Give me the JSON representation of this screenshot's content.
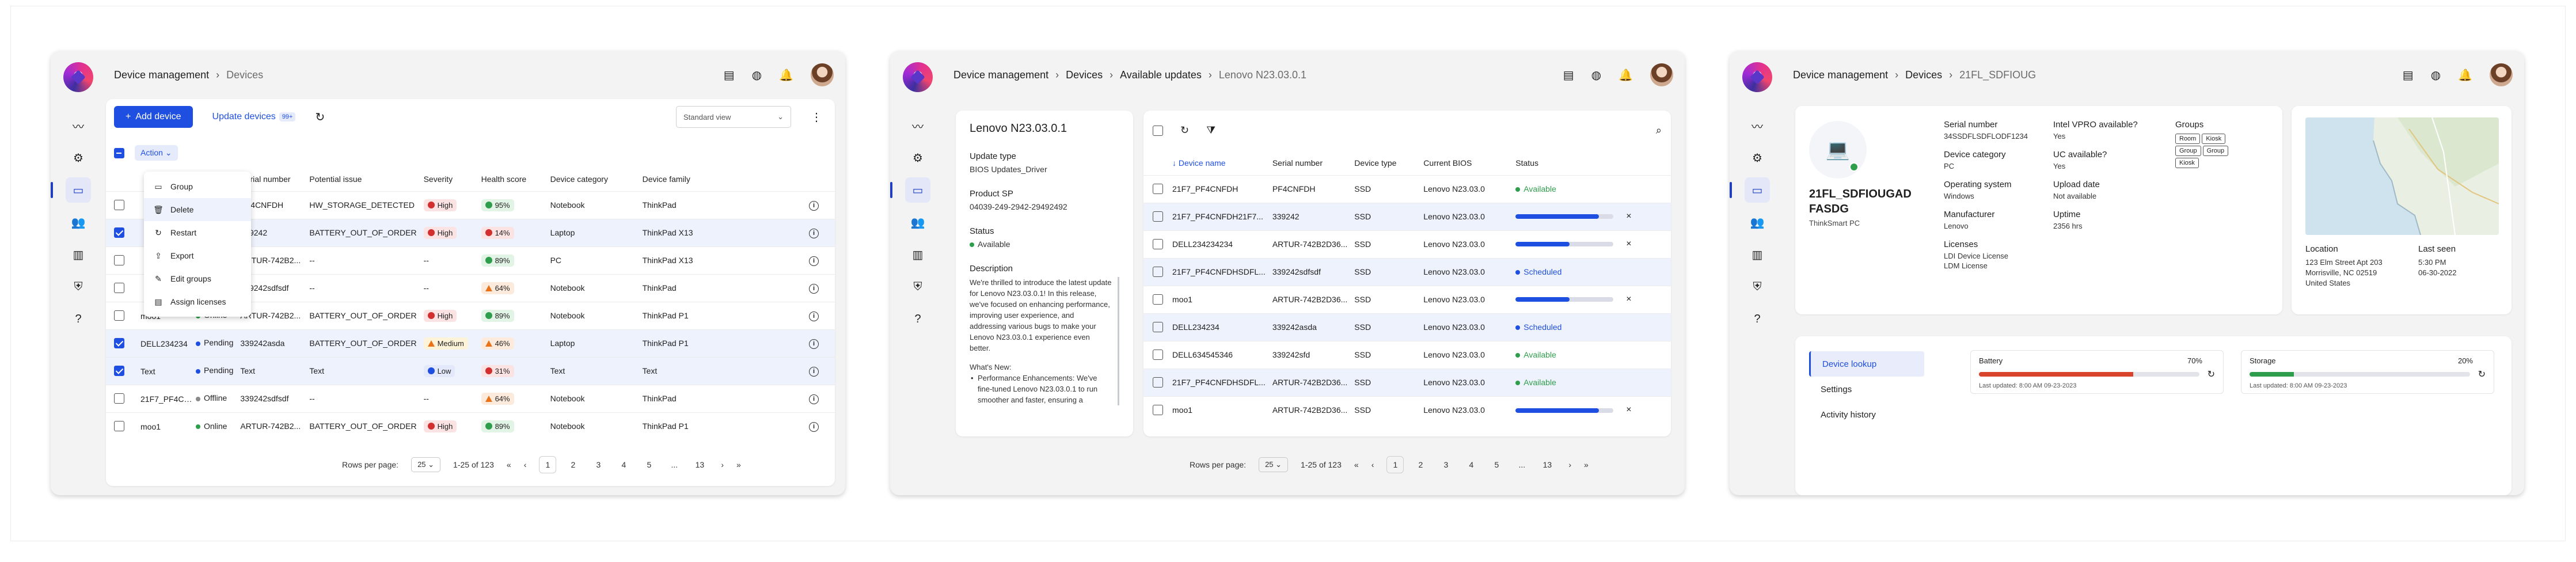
{
  "screen1": {
    "breadcrumb": [
      "Device management",
      "Devices"
    ],
    "add_device": "Add device",
    "update_devices": "Update devices",
    "update_chip": "99+",
    "view_select": "Standard view",
    "action_label": "Action",
    "columns": [
      "",
      "Status",
      "Serial number",
      "Potential issue",
      "Severity",
      "Health score",
      "Device category",
      "Device family",
      ""
    ],
    "rows": [
      {
        "sel": false,
        "name": "",
        "status": "Offline",
        "status_color": "#8a8a8a",
        "serial": "PF4CNFDH",
        "issue": "HW_STORAGE_DETECTED",
        "severity": "High",
        "sev": "high",
        "health": "95%",
        "hc": "green",
        "category": "Notebook",
        "family": "ThinkPad"
      },
      {
        "sel": true,
        "name": "",
        "status": "Offline",
        "status_color": "#8a8a8a",
        "serial": "339242",
        "issue": "BATTERY_OUT_OF_ORDER",
        "severity": "High",
        "sev": "high",
        "health": "14%",
        "hc": "red",
        "category": "Laptop",
        "family": "ThinkPad X13"
      },
      {
        "sel": false,
        "name": "",
        "status": "Online",
        "status_color": "#2e9e4c",
        "serial": "ARTUR-742B2...",
        "issue": "--",
        "severity": "--",
        "sev": "",
        "health": "89%",
        "hc": "green",
        "category": "PC",
        "family": "ThinkPad X13"
      },
      {
        "sel": false,
        "name": "",
        "status": "Offline",
        "status_color": "#8a8a8a",
        "serial": "339242sdfsdf",
        "issue": "--",
        "severity": "--",
        "sev": "",
        "health": "64%",
        "hc": "orange",
        "category": "Notebook",
        "family": "ThinkPad"
      },
      {
        "sel": false,
        "name": "moo1",
        "status": "Online",
        "status_color": "#2e9e4c",
        "serial": "ARTUR-742B2...",
        "issue": "BATTERY_OUT_OF_ORDER",
        "severity": "High",
        "sev": "high",
        "health": "89%",
        "hc": "green",
        "category": "Notebook",
        "family": "ThinkPad P1"
      },
      {
        "sel": true,
        "name": "DELL234234",
        "status": "Pending",
        "status_color": "#1f4fe0",
        "serial": "339242asda",
        "issue": "BATTERY_OUT_OF_ORDER",
        "severity": "Medium",
        "sev": "med",
        "health": "46%",
        "hc": "orange",
        "category": "Laptop",
        "family": "ThinkPad P1"
      },
      {
        "sel": true,
        "name": "Text",
        "status": "Pending",
        "status_color": "#1f4fe0",
        "serial": "Text",
        "issue": "Text",
        "severity": "Low",
        "sev": "low",
        "health": "31%",
        "hc": "red",
        "category": "Text",
        "family": "Text"
      },
      {
        "sel": false,
        "name": "21F7_PF4CNFDHSDFL...",
        "status": "Offline",
        "status_color": "#8a8a8a",
        "serial": "339242sdfsdf",
        "issue": "--",
        "severity": "--",
        "sev": "",
        "health": "64%",
        "hc": "orange",
        "category": "Notebook",
        "family": "ThinkPad"
      },
      {
        "sel": false,
        "name": "moo1",
        "status": "Online",
        "status_color": "#2e9e4c",
        "serial": "ARTUR-742B2...",
        "issue": "BATTERY_OUT_OF_ORDER",
        "severity": "High",
        "sev": "high",
        "health": "89%",
        "hc": "green",
        "category": "Notebook",
        "family": "ThinkPad P1"
      }
    ],
    "menu": [
      "Group",
      "Delete",
      "Restart",
      "Export",
      "Edit groups",
      "Assign licenses"
    ],
    "menu_icons": [
      "group-icon",
      "delete-icon",
      "restart-icon",
      "export-icon",
      "edit-icon",
      "license-icon"
    ],
    "menu_glyphs": [
      "▭",
      "🗑",
      "↻",
      "⇪",
      "✎",
      "▤"
    ],
    "pager": {
      "rows_label": "Rows per page:",
      "rows_value": "25",
      "range": "1-25 of 123",
      "pages": [
        "1",
        "2",
        "3",
        "4",
        "5",
        "...",
        "13"
      ]
    }
  },
  "screen2": {
    "breadcrumb": [
      "Device management",
      "Devices",
      "Available updates",
      "Lenovo N23.03.0.1"
    ],
    "title": "Lenovo N23.03.0.1",
    "fields": [
      {
        "label": "Update type",
        "value": "BIOS Updates_Driver"
      },
      {
        "label": "Product SP",
        "value": "04039-249-2942-29492492"
      }
    ],
    "status_label": "Status",
    "status_value": "Available",
    "description_label": "Description",
    "description": "We're thrilled to introduce the latest update for Lenovo N23.03.0.1! In this release, we've focused on enhancing performance, improving user experience, and addressing various bugs to make your Lenovo N23.03.0.1 experience even better.",
    "whats_new": "What's New:",
    "bullet": "Performance Enhancements: We've fine-tuned Lenovo N23.03.0.1 to run smoother and faster, ensuring a",
    "columns": [
      "Device name",
      "Serial number",
      "Device type",
      "Current BIOS",
      "Status"
    ],
    "rows": [
      {
        "name": "21F7_PF4CNFDH",
        "serial": "PF4CNFDH",
        "type": "SSD",
        "bios": "Lenovo N23.03.0",
        "status": "Available",
        "kind": "text",
        "progress": 0,
        "sel": false
      },
      {
        "name": "21F7_PF4CNFDH21F7...",
        "serial": "339242",
        "type": "SSD",
        "bios": "Lenovo N23.03.0",
        "status": "",
        "kind": "bar",
        "progress": 0.85,
        "sel": true
      },
      {
        "name": "DELL234234234",
        "serial": "ARTUR-742B2D36...",
        "type": "SSD",
        "bios": "Lenovo N23.03.0",
        "status": "",
        "kind": "bar",
        "progress": 0.55,
        "sel": false
      },
      {
        "name": "21F7_PF4CNFDHSDFL...",
        "serial": "339242sdfsdf",
        "type": "SSD",
        "bios": "Lenovo N23.03.0",
        "status": "Scheduled",
        "kind": "text",
        "progress": 0,
        "sel": true
      },
      {
        "name": "moo1",
        "serial": "ARTUR-742B2D36...",
        "type": "SSD",
        "bios": "Lenovo N23.03.0",
        "status": "",
        "kind": "bar",
        "progress": 0.55,
        "sel": false
      },
      {
        "name": "DELL234234",
        "serial": "339242asda",
        "type": "SSD",
        "bios": "Lenovo N23.03.0",
        "status": "Scheduled",
        "kind": "text",
        "progress": 0,
        "sel": true
      },
      {
        "name": "DELL634545346",
        "serial": "339242sfd",
        "type": "SSD",
        "bios": "Lenovo N23.03.0",
        "status": "Available",
        "kind": "text",
        "progress": 0,
        "sel": false
      },
      {
        "name": "21F7_PF4CNFDHSDFL...",
        "serial": "ARTUR-742B2D36...",
        "type": "SSD",
        "bios": "Lenovo N23.03.0",
        "status": "Available",
        "kind": "text",
        "progress": 0,
        "sel": true
      },
      {
        "name": "moo1",
        "serial": "ARTUR-742B2D36...",
        "type": "SSD",
        "bios": "Lenovo N23.03.0",
        "status": "",
        "kind": "bar",
        "progress": 0.85,
        "sel": false
      }
    ],
    "pager": {
      "rows_label": "Rows per page:",
      "rows_value": "25",
      "range": "1-25 of 123",
      "pages": [
        "1",
        "2",
        "3",
        "4",
        "5",
        "...",
        "13"
      ]
    }
  },
  "screen3": {
    "breadcrumb": [
      "Device management",
      "Devices",
      "21FL_SDFIOUG"
    ],
    "device_name": "21FL_SDFIOUGAD FASDG",
    "device_model": "ThinkSmart PC",
    "col1": [
      {
        "label": "Serial number",
        "value": "34SSDFLSDFLODF1234"
      },
      {
        "label": "Device category",
        "value": "PC"
      },
      {
        "label": "Operating system",
        "value": "Windows"
      },
      {
        "label": "Manufacturer",
        "value": "Lenovo"
      },
      {
        "label": "Licenses",
        "value": "LDI Device License"
      }
    ],
    "license2": "LDM License",
    "col2": [
      {
        "label": "Intel VPRO available?",
        "value": "Yes"
      },
      {
        "label": "UC available?",
        "value": "Yes"
      },
      {
        "label": "Upload date",
        "value": "Not available"
      },
      {
        "label": "Uptime",
        "value": "2356 hrs"
      }
    ],
    "groups_label": "Groups",
    "groups": [
      "Room",
      "Kiosk",
      "Group",
      "Group",
      "Kiosk"
    ],
    "location_label": "Location",
    "location": [
      "123 Elm Street Apt 203",
      "Morrisville, NC 02519",
      "United States"
    ],
    "last_seen_label": "Last seen",
    "last_seen": [
      "5:30 PM",
      "06-30-2022"
    ],
    "nav": [
      "Device lookup",
      "Settings",
      "Activity history"
    ],
    "battery": {
      "label": "Battery",
      "pct": "70%",
      "updated": "Last updated: 8:00 AM 09-23-2023",
      "fill": 0.7,
      "color": "#d9442c"
    },
    "storage": {
      "label": "Storage",
      "pct": "20%",
      "updated": "Last updated: 8:00 AM 09-23-2023",
      "fill": 0.2,
      "color": "#2e9e4c"
    }
  }
}
